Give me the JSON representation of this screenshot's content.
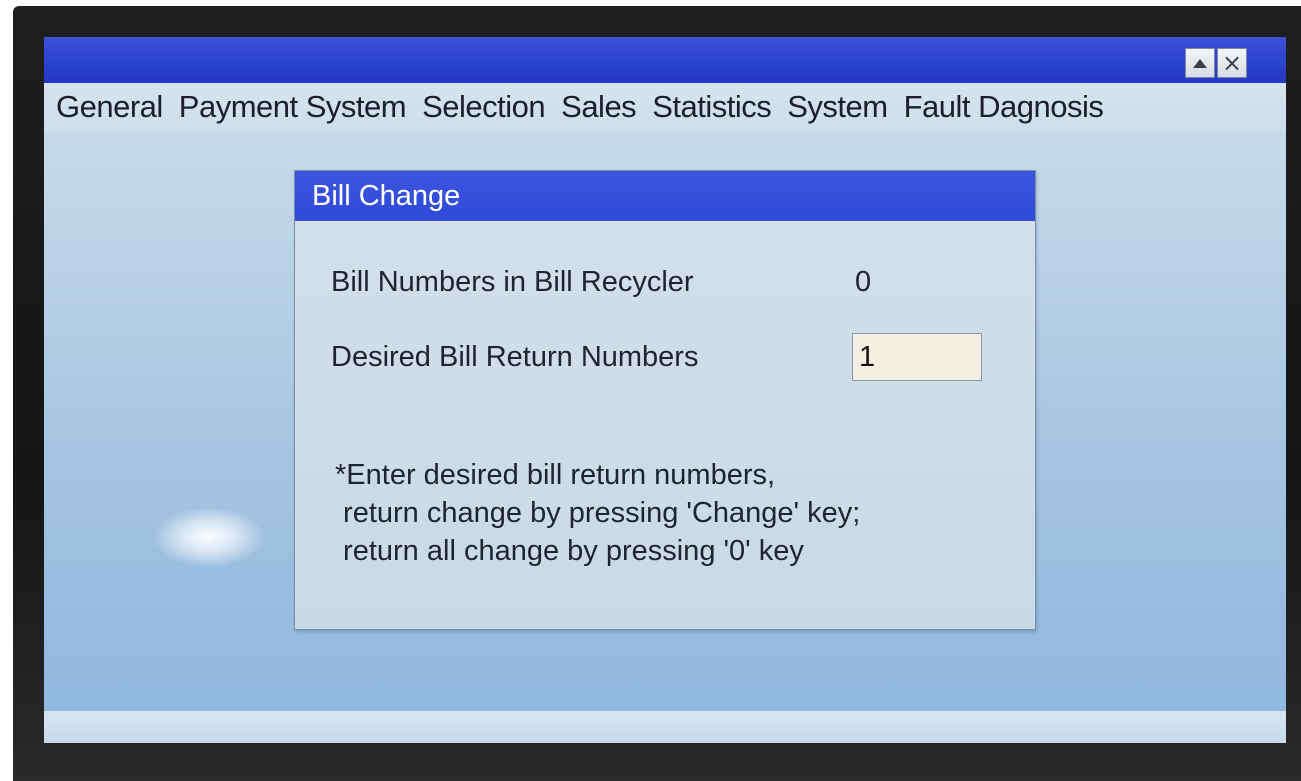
{
  "window": {
    "buttons": [
      {
        "name": "scroll-up",
        "icon": "triangle-up-icon"
      },
      {
        "name": "close",
        "label": "×",
        "icon": "close-icon"
      }
    ]
  },
  "menu": {
    "items": [
      "General",
      "Payment System",
      "Selection",
      "Sales",
      "Statistics",
      "System",
      "Fault Dagnosis"
    ]
  },
  "dialog": {
    "title": "Bill Change",
    "recycler_label": "Bill Numbers in Bill Recycler",
    "recycler_value": "0",
    "return_label": "Desired Bill Return Numbers",
    "return_value": "1",
    "hint_lines": [
      "*Enter desired bill return numbers,",
      " return change by pressing 'Change' key;",
      " return all change by pressing '0' key"
    ]
  },
  "colors": {
    "titlebar": "#2d44d2",
    "dialog_title": "#3450dc",
    "screen_background": "#b4cde6",
    "input_background": "#f3f0e3"
  }
}
